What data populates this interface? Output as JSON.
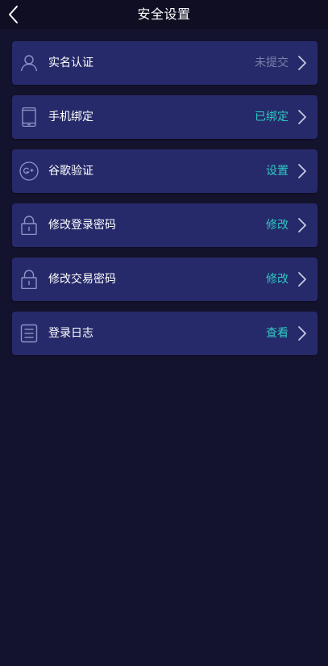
{
  "header": {
    "title": "安全设置"
  },
  "colors": {
    "status_muted": "#7b7fa9",
    "status_accent": "#2ec9c3",
    "icon_stroke": "#8e93c7"
  },
  "items": [
    {
      "icon": "user-icon",
      "label": "实名认证",
      "status": "未提交",
      "status_style": "muted"
    },
    {
      "icon": "phone-icon",
      "label": "手机绑定",
      "status": "已绑定",
      "status_style": "accent"
    },
    {
      "icon": "google-plus-icon",
      "label": "谷歌验证",
      "status": "设置",
      "status_style": "accent"
    },
    {
      "icon": "lock-icon",
      "label": "修改登录密码",
      "status": "修改",
      "status_style": "accent"
    },
    {
      "icon": "lock-icon",
      "label": "修改交易密码",
      "status": "修改",
      "status_style": "accent"
    },
    {
      "icon": "list-icon",
      "label": "登录日志",
      "status": "查看",
      "status_style": "accent"
    }
  ]
}
